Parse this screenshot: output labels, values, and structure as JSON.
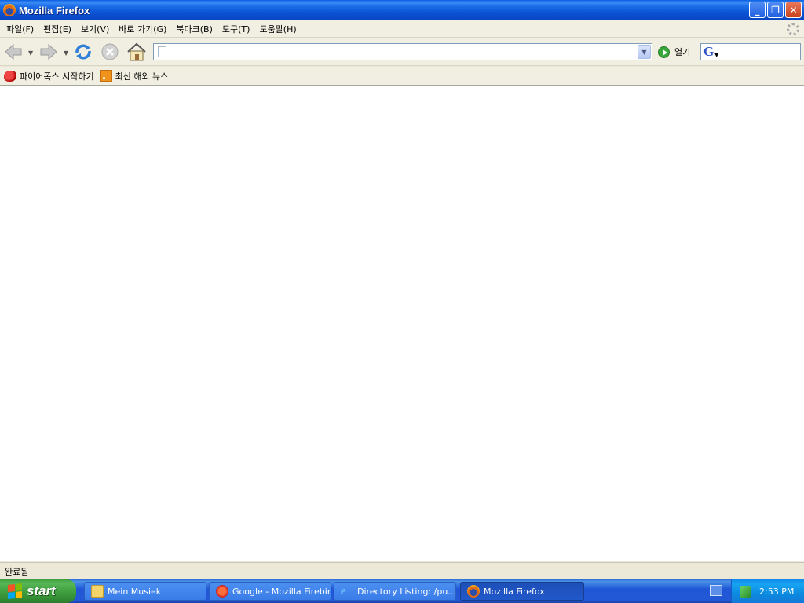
{
  "window": {
    "title": "Mozilla Firefox",
    "buttons": {
      "minimize": "_",
      "restore": "❐",
      "close": "✕"
    }
  },
  "menu": [
    "파일(F)",
    "편집(E)",
    "보기(V)",
    "바로 가기(G)",
    "북마크(B)",
    "도구(T)",
    "도움말(H)"
  ],
  "navigation": {
    "url_value": "",
    "go_label": "열기",
    "search_value": ""
  },
  "bookmarks": [
    {
      "label": "파이어폭스 시작하기",
      "icon": "firefox-start-icon"
    },
    {
      "label": "최신 해외 뉴스",
      "icon": "rss-feed-icon"
    }
  ],
  "status": {
    "text": "완료됨"
  },
  "taskbar": {
    "start_label": "start",
    "tasks": [
      {
        "label": "Mein Musiek",
        "icon": "folder-icon"
      },
      {
        "label": "Google - Mozilla Firebird",
        "icon": "firebird-icon"
      },
      {
        "label": "Directory Listing: /pu...",
        "icon": "internet-explorer-icon"
      },
      {
        "label": "Mozilla Firefox",
        "icon": "firefox-icon",
        "active": true
      }
    ],
    "clock": "2:53 PM"
  },
  "colors": {
    "titlebar": "#0A54D6",
    "start_button": "#3B9A3B",
    "taskbar": "#2257D5",
    "tray": "#0B8BE0"
  }
}
